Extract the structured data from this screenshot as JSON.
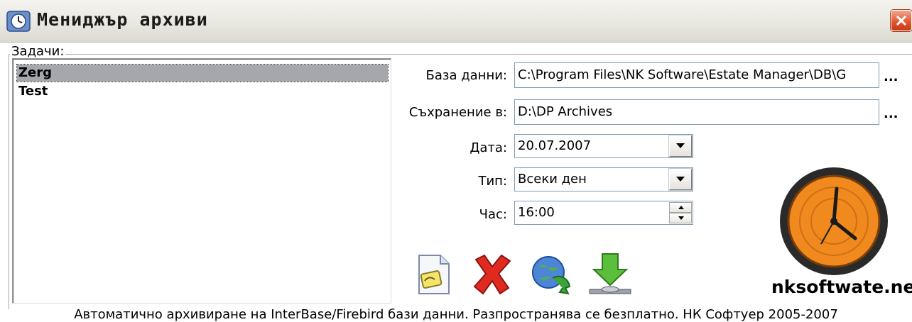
{
  "window": {
    "title": "Мениджър архиви"
  },
  "tasks": {
    "label": "Задачи:",
    "items": [
      {
        "name": "Zerg",
        "selected": true
      },
      {
        "name": "Test",
        "selected": false
      }
    ]
  },
  "form": {
    "database_label": "База данни:",
    "database_value": "C:\\Program Files\\NK Software\\Estate Manager\\DB\\G",
    "save_label": "Съхранение в:",
    "save_value": "D:\\DP Archives",
    "browse_label": "...",
    "date_label": "Дата:",
    "date_value": "20.07.2007",
    "type_label": "Тип:",
    "type_value": "Всеки ден",
    "time_label": "Час:",
    "time_value": "16:00"
  },
  "toolbar": {
    "new_icon": "new-task-icon",
    "delete_icon": "delete-icon",
    "refresh_icon": "refresh-icon",
    "download_icon": "download-icon"
  },
  "branding": {
    "site": "nksoftwate.net"
  },
  "footer": {
    "text": "Автоматично архивиране на InterBase/Firebird бази данни. Разпространява се безплатно. НК Софтуер 2005-2007"
  },
  "colors": {
    "selection": "#a6a6ad",
    "input_border": "#7f9db9",
    "close_button": "#e2522c",
    "clock_orange": "#f08a1e"
  }
}
